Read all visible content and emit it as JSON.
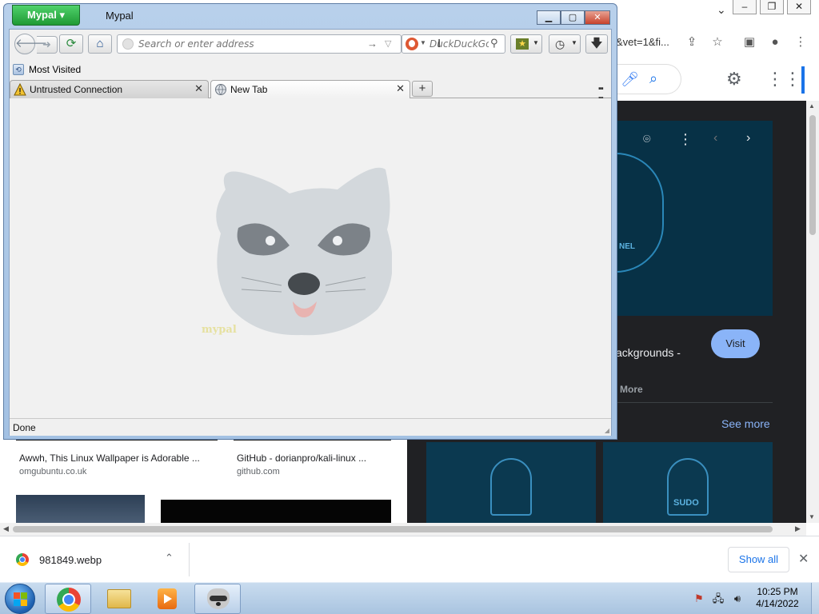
{
  "background_browser": {
    "url_fragment": "&vet=1&fi...",
    "image_panel": {
      "emblem_text": "NEL",
      "card_title": "ackgrounds -",
      "visit_label": "Visit",
      "more_label": "More",
      "see_more_label": "See more",
      "sudo_text": "SUDO"
    },
    "results": [
      {
        "title": "Awwh, This Linux Wallpaper is Adorable ...",
        "source": "omgubuntu.co.uk"
      },
      {
        "title": "GitHub - dorianpro/kali-linux ...",
        "source": "github.com"
      }
    ]
  },
  "download_bar": {
    "file_name": "981849.webp",
    "show_all_label": "Show all"
  },
  "mypal": {
    "app_button_label": "Mypal",
    "window_title": "Mypal",
    "address_placeholder": "Search or enter address",
    "search_placeholder": "DuckDuckGo",
    "bookmarks": [
      {
        "label": "Most Visited"
      }
    ],
    "tabs": [
      {
        "label": "Untrusted Connection",
        "icon": "warning-icon",
        "selected": false
      },
      {
        "label": "New Tab",
        "icon": "globe-icon",
        "selected": true
      }
    ],
    "logo_text": "mypal",
    "status_text": "Done"
  },
  "taskbar": {
    "time": "10:25 PM",
    "date": "4/14/2022"
  },
  "colors": {
    "mypal_accent": "#1f9a35",
    "google_blue": "#1a73e8",
    "visit_button": "#8ab4f8",
    "dark_panel": "#202124"
  }
}
